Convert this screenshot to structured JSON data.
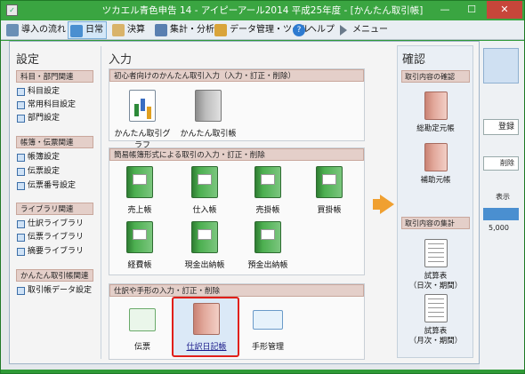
{
  "window": {
    "title": "ツカエル青色申告 14 - アイピーアール2014 平成25年度 - [かんたん取引帳]",
    "controls": {
      "minimize": "—",
      "maximize": "☐",
      "close": "✕"
    }
  },
  "menu": [
    {
      "label": "導入の流れ",
      "icon": "guide-icon"
    },
    {
      "label": "日常",
      "icon": "daily-icon",
      "active": true
    },
    {
      "label": "決算",
      "icon": "settlement-icon"
    },
    {
      "label": "集計・分析",
      "icon": "analysis-icon"
    },
    {
      "label": "データ管理・ツール",
      "icon": "data-tools-icon"
    },
    {
      "label": "ヘルプ",
      "icon": "help-icon"
    },
    {
      "label": "メニュー",
      "icon": "menu-arrow-icon"
    }
  ],
  "settings": {
    "title": "設定",
    "sections": [
      {
        "header": "科目・部門関連",
        "items": [
          "科目設定",
          "常用科目設定",
          "部門設定"
        ]
      },
      {
        "header": "帳簿・伝票関連",
        "items": [
          "帳簿設定",
          "伝票設定",
          "伝票番号設定"
        ]
      },
      {
        "header": "ライブラリ関連",
        "items": [
          "仕訳ライブラリ",
          "伝票ライブラリ",
          "摘要ライブラリ"
        ]
      },
      {
        "header": "かんたん取引帳関連",
        "items": [
          "取引帳データ設定"
        ]
      }
    ]
  },
  "input": {
    "title": "入力",
    "sections": [
      {
        "header": "初心者向けのかんたん取引入力（入力・訂正・削除）",
        "tiles": [
          "かんたん取引グラフ",
          "かんたん取引帳"
        ]
      },
      {
        "header": "簡易帳簿形式による取引の入力・訂正・削除",
        "tiles": [
          "売上帳",
          "仕入帳",
          "売掛帳",
          "買掛帳",
          "経費帳",
          "現金出納帳",
          "預金出納帳"
        ]
      },
      {
        "header": "仕訳や手形の入力・訂正・削除",
        "tiles": [
          "伝票",
          "仕訳日記帳",
          "手形管理"
        ]
      }
    ]
  },
  "confirm": {
    "title": "確認",
    "sections": [
      {
        "header": "取引内容の確認",
        "tiles": [
          "総勘定元帳",
          "補助元帳"
        ]
      },
      {
        "header": "取引内容の集計",
        "tiles": [
          "試算表\n（日次・期間）",
          "試算表\n（月次・期間）"
        ]
      }
    ]
  },
  "background": {
    "register": "登録",
    "delete": "削除",
    "display": "表示",
    "amount": "5,000"
  },
  "colors": {
    "accent": "#3aa541",
    "highlight": "#e0201a",
    "arrow": "#f0a030"
  }
}
